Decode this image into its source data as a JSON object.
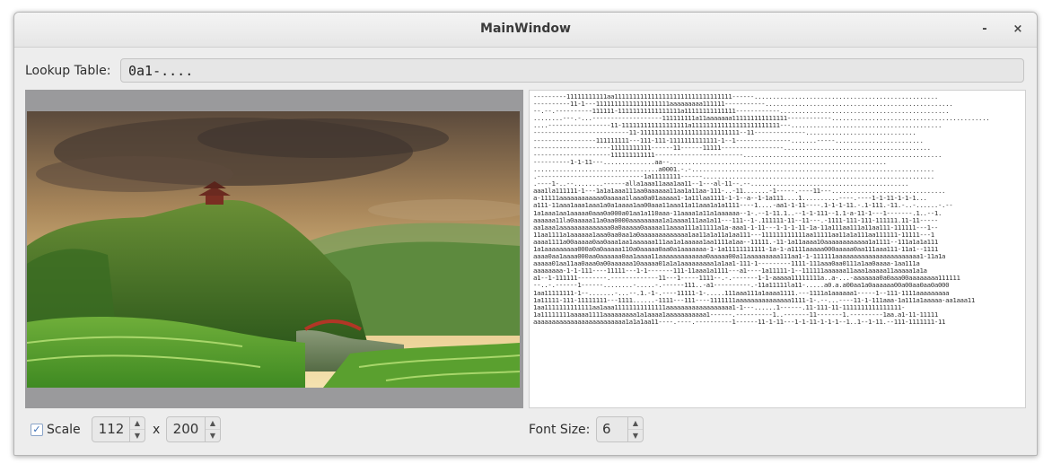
{
  "window": {
    "title": "MainWindow",
    "minimize_glyph": "-",
    "close_glyph": "×"
  },
  "lookup": {
    "label": "Lookup Table:",
    "value": "0a1-...."
  },
  "image": {
    "subject": "landscape-image"
  },
  "ascii": {
    "lines": [
      "---------11111111111aa11111111111111111111111111111111------..................................................",
      "----------11-1---11111111111111111111aaaaaaaaa111111-----------...................................................",
      "--.--.----------111111-11111111111111111a11111111111111------------..............................................",
      "........---.-...-------------------111111111a11aaaaaaa111111111111111------------...........................................",
      "....-----------------11-111111111111111111a111111111111111111111111---.........................................",
      "--------------------------11-111111111111111111111111111--11--------------..............................",
      "-----------------111111111---111-111-1111111111111-1--1---------------.......-----........................",
      "---------------------11111111111------11------11111-----------------........................................",
      "---------------------111111111111------------------------......................................................",
      "----------1-1-11---..............aa--...........................................................",
      "..................................a0001.-.-..................................................................",
      ".-----------------------------1a11111111------...............................................................",
      ".----1-..--........------alla1aaa11aaa1aa11--1---al-11--.--...........................................",
      "aaa1la111111-1---1a1a1aaa111aa0aaaaaa11aa1a11aa-111-..-11.......-1-----.----11---...............................",
      "a-11111aaaaaaaaaaaa0aaaaa1laaa0a01aaaaa1-1a11laa1111-1-1--a--1-1a111....1..........----.----1-1-11-1-1-1...",
      "a111-11aaa1aaa1aaa1a0a1aaaa1aa00aaa11aaa11a11aaa1a1a1111----1....-aa1-1-11----.1-1-1-11.-.1-111.-11.-..-......-.--",
      "1a1aaa1aa1aaaaa0aaa0a000a01aa1a110aaa-11aaaa1a11a1aaaaaa--1-.--1-11.1..--1-1-111--1.1-a-11-1---1-------.1..--1.",
      "aaaaaa11la0aaaaa11a0aa0000aaaaaaaaa1a1aaaa111aa1a11---111--1-.111111-11--11---.-1111-111-111-111111.11-11-----",
      "aa1aaa1aaaaaaaaaaaaaa0a0aaaaa0aaaaa11aaaa111a11111a1a-aaa1-1-11---1-1-1-11-1a-11a111aa111a11aa111-111111---1--",
      "11aa1111a1aaaaaa1aaa0aa0aa1a0aaaaaaaaaaaaa1aa11a1a11a1aa111---111111111111aa11111aa11a1a111aa111111-11111---1",
      "aaaa1111a00aaaaa0aa0aaa1aa1aaaaaa111aa1a1aaaaa1aa1111a1aa--11111.-11-1a11aaaa10aaaaaaaaaaaa1a1111--111a1a1a111",
      "1a1aaaaaaaaa000a0a0aaaaa110a0aaaaa0aa0a1aaaaaaa-1-1a11111111111-1a-1-a1111aaaaa000aaaaa0aa111aaa111-11a1--1111",
      "aaaa0aa1aaaa000aa0aaaaaa0aa1aaaa11aaaaaaaaaaaaa0aaaaa00a11aaaaaaaaa111aa1-1-111111aaaaaaaaaaaaaaaaaaaaaaa1-11a1a",
      "aaaaa01aa11aa0aaa0a00aaaaaa10aaaaa01a1a1aaaaaaaaa1a1aa1-111-1---------1111-111aaa0aa0111a1aa0aaaa-1aa111a",
      "aaaaaaaa-1-1-111----11111---1-1-------111-11aaa1a1111---a1----1a11111-1--111111aaaaaa11aaa1aaaaa11aaaaa1a1a",
      "a1--1-111111--------.-------------11---1-----1111--.-.-------1-1-aaaaa11111111a..a-...-aaaaaaa0a0aaa00aaaaaaaa111111",
      "--..-.------1------........-.....-.------111..-a1----------.-11a11111la11-.....a0.a.a00aa1a0aaaaaa00a00aa0aa0a000",
      "1aa11111111-1--.......-...--.1.-1-.----11111-1-.....111aaa111a1aaaa1111.---1111a1aaaaaa1-----1--111-1111aaaaaaaaa",
      "1a11111-111-11111111---1111......-1111---111----1111111aaaaaaaaaaaaaaa1111-1-.--...----11-1-111aaa-1a111a1aaaaa-aa1aaa11",
      "1aa1111111111111aa1aaa11111111111111aaaaaaaaaaaaaaaaaa1-1---......1------.11-111-11-1111111111111111-",
      "1a11111111aaaaa1111aaaaaaaaa1a1aaaa1aaaaaaaaaaa1------.----------1..-------11-------1.---------1aa.a1-11-11111",
      "aaaaaaaaaaaaaaaaaaaaaaaaa1a1a1aa11----.----.----------1------11-1-11---1-1-11-1-1-1--1..1--1-11.--111-1111111-11"
    ]
  },
  "scale": {
    "label": "Scale",
    "checked_glyph": "✓",
    "width": "112",
    "separator": "x",
    "height": "200"
  },
  "font": {
    "label": "Font Size:",
    "value": "6"
  }
}
